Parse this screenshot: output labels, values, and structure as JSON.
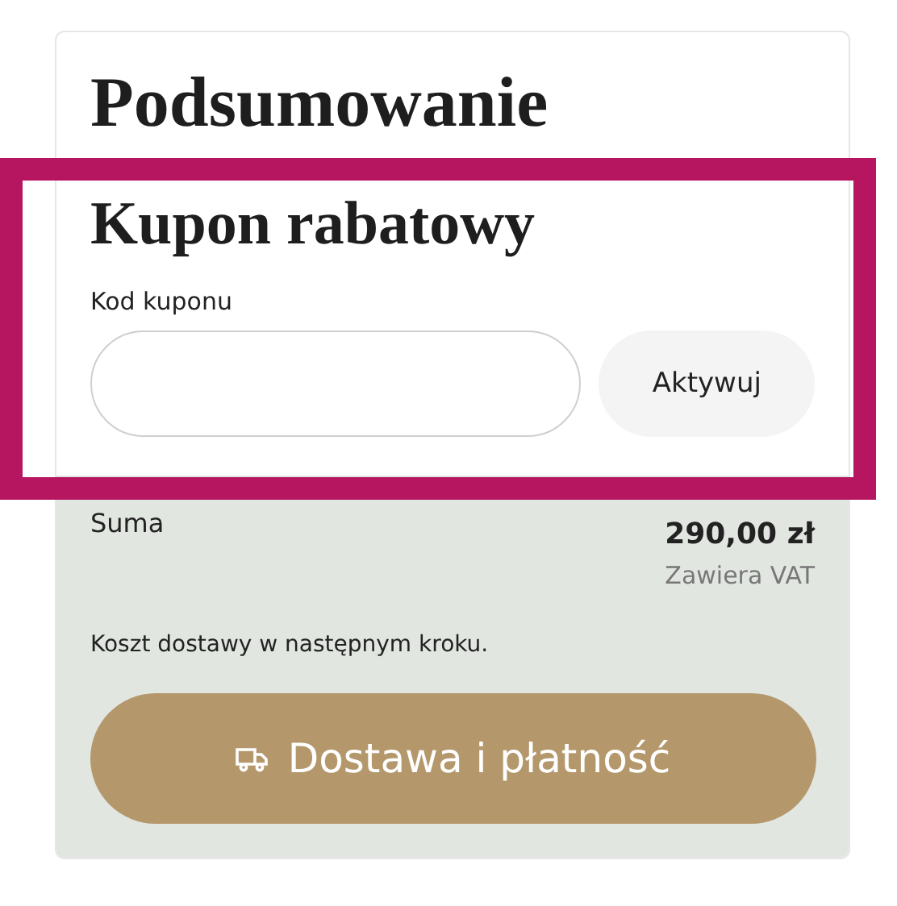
{
  "title": "Podsumowanie",
  "coupon": {
    "heading": "Kupon rabatowy",
    "label": "Kod kuponu",
    "button": "Aktywuj"
  },
  "total": {
    "label": "Suma",
    "amount": "290,00 zł",
    "tax_note": "Zawiera VAT"
  },
  "shipping_note": "Koszt dostawy w następnym kroku.",
  "checkout_button": "Dostawa i płatność"
}
